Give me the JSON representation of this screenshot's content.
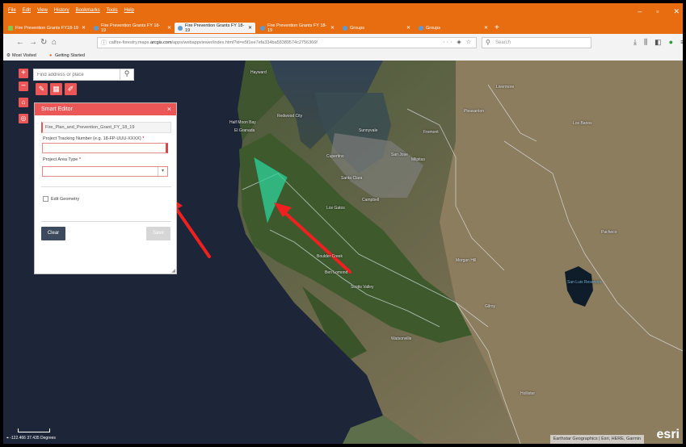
{
  "browser": {
    "menu": [
      "File",
      "Edit",
      "View",
      "History",
      "Bookmarks",
      "Tools",
      "Help"
    ],
    "tabs": [
      {
        "label": "Fire Prevention Grants FY18-19",
        "active": false
      },
      {
        "label": "Fire Prevention Grants FY 18-19",
        "active": false
      },
      {
        "label": "Fire Prevention Grants FY 18-19",
        "active": true
      },
      {
        "label": "Fire Prevention Grants FY 18-19",
        "active": false
      },
      {
        "label": "Groups",
        "active": false
      },
      {
        "label": "Groups",
        "active": false
      }
    ],
    "url_prefix": "calfire-forestry.maps.",
    "url_domain": "arcgis.com",
    "url_suffix": "/apps/webappviewer/index.html?id=e5f1ee7efa334ba58389574c2756366f",
    "search_placeholder": "Search",
    "bookmarks": [
      "Most Visited",
      "Getting Started"
    ]
  },
  "map": {
    "search_placeholder": "Find address or place",
    "coordinates": "-122.466 37.435 Degrees",
    "attribution": "Earthstar Geographics | Esri, HERE, Garmin",
    "logo": "esri",
    "places": [
      "Hayward",
      "Redwood City",
      "Half Moon Bay",
      "Sunnyvale",
      "Santa Clara",
      "San Jose",
      "Campbell",
      "Cupertino",
      "Los Gatos",
      "Scotts Valley",
      "Ben Lomond",
      "Boulder Creek",
      "Watsonville",
      "San Luis Reservoir",
      "Gilroy",
      "Morgan Hill",
      "Livermore",
      "Pleasanton",
      "Fremont",
      "Milpitas",
      "Hollister",
      "El Granada",
      "Los Banos",
      "Pacheco"
    ]
  },
  "editor": {
    "title": "Smart Editor",
    "layer_name": "Fire_Plan_and_Prevention_Grant_FY_18_19",
    "field1_label": "Project Tracking Number (e.g. 18-FP-UUU-XXXX)",
    "field2_label": "Project Area Type",
    "required_mark": "*",
    "checkbox_label": "Edit Geometry",
    "clear_label": "Clear",
    "save_label": "Save"
  },
  "colors": {
    "firefox_orange": "#e86d11",
    "widget_red": "#ea5756",
    "polygon_fill": "#2fd39a",
    "arrow_red": "#f02020"
  }
}
